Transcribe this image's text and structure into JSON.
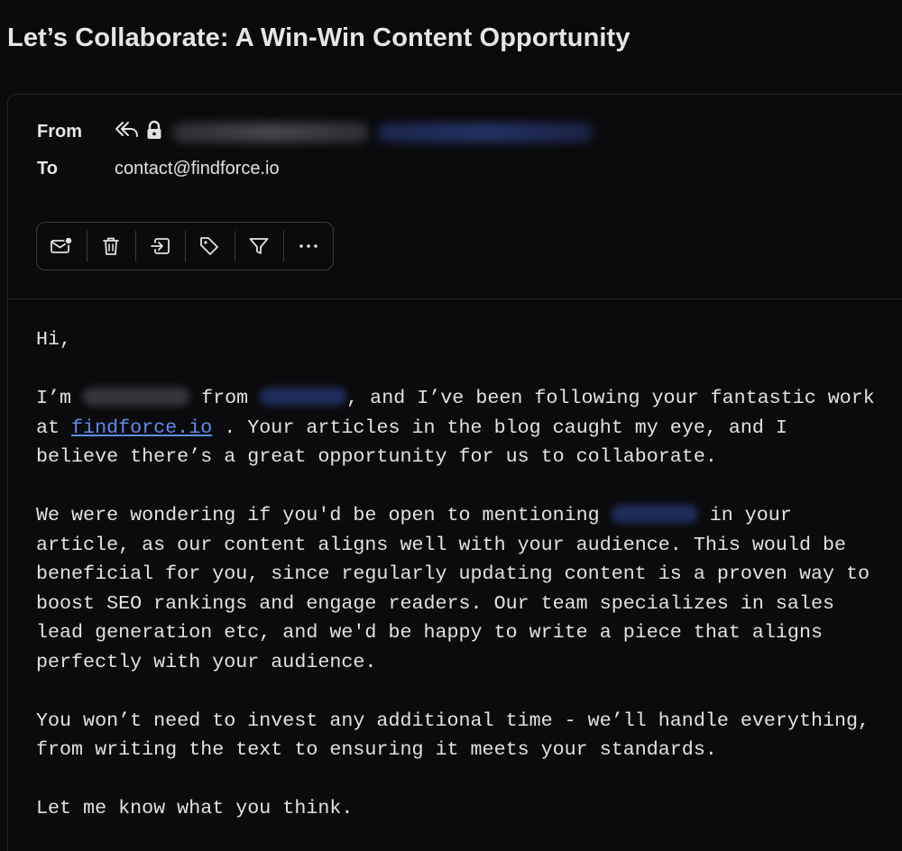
{
  "email": {
    "subject": "Let’s Collaborate: A Win-Win Content Opportunity",
    "from_label": "From",
    "to_label": "To",
    "to_address": "contact@findforce.io"
  },
  "toolbar": {
    "buttons": [
      {
        "name": "mark-unread",
        "icon": "mail-unread-icon"
      },
      {
        "name": "delete",
        "icon": "trash-icon"
      },
      {
        "name": "move",
        "icon": "move-to-icon"
      },
      {
        "name": "tag",
        "icon": "tag-icon"
      },
      {
        "name": "filter",
        "icon": "filter-icon"
      },
      {
        "name": "more",
        "icon": "more-icon"
      }
    ]
  },
  "body": {
    "greeting": "Hi,",
    "p1_a": "I’m",
    "p1_b": "from",
    "p1_c": ", and I’ve been following your fantastic work at",
    "p1_link": "findforce.io",
    "p1_d": ". Your articles in the blog caught my eye, and I believe there’s a great opportunity for us to collaborate.",
    "p2_a": "We were wondering if you'd be open to mentioning",
    "p2_b": "in your article, as our content aligns well with your audience. This would be beneficial for you, since regularly updating content is a proven way to boost SEO rankings and engage readers. Our team specializes in sales lead generation etc, and we'd be happy to write a piece that aligns perfectly with your audience.",
    "p3": "You won’t need to invest any additional time - we’ll handle everything, from writing the text to ensuring it meets your standards.",
    "p4": "Let me know what you think."
  },
  "colors": {
    "background": "#0a0a0c",
    "text": "#e2e2e4",
    "link": "#5b8def",
    "border": "#3a3b40"
  }
}
